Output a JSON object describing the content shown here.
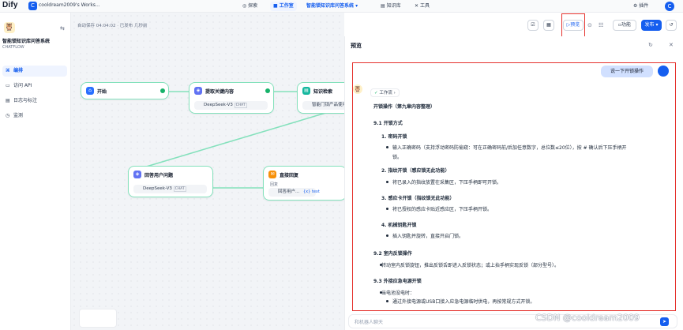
{
  "topbar": {
    "logo": "Dify",
    "ws_initial": "C",
    "ws_name": "cooldream2009's Works...",
    "explore": "探索",
    "studio": "工作室",
    "app_name": "智能锁知识库问答系统",
    "knowledge": "知识库",
    "tools": "工具",
    "account_menu": "插件",
    "user_initial": "C"
  },
  "sidebar": {
    "app_title": "智能锁知识库问答系统",
    "app_type": "CHATFLOW",
    "items": [
      {
        "label": "编排",
        "icon": "orchestrate-icon"
      },
      {
        "label": "访问 API",
        "icon": "api-icon"
      },
      {
        "label": "日志与标注",
        "icon": "log-icon"
      },
      {
        "label": "监测",
        "icon": "monitor-icon"
      }
    ]
  },
  "canvas": {
    "autosave": "自动保存 04:04:02 · 已发布 几秒前",
    "nodes": {
      "start": "开始",
      "extract": "提取关键内容",
      "extract_model": "DeepSeek-V3",
      "chat_tag": "CHAT",
      "kb": "知识检索",
      "kb_sub": "智能门锁产品使用手册",
      "answer_q": "回答用户问题",
      "answer_model": "DeepSeek-V3",
      "answer_tag": "CHAT",
      "direct": "直接回复",
      "direct_label": "回复",
      "direct_var": "回答用户...",
      "direct_var_type": "{x} text"
    }
  },
  "toolbar": {
    "preview": "预览",
    "features": "功能",
    "publish": "发布"
  },
  "preview": {
    "title": "预览",
    "user_msg": "说一下开锁操作",
    "workflow_label": "工作流",
    "input_placeholder": "和机器人聊天",
    "lines": [
      "开锁操作（第九章内容整理）",
      "9.1 开锁方式",
      "1. 密码开锁",
      "输入正确密码（支持浮动密码防偷窥：可在正确密码前/后加任意数字，总位数≤20位），按 # 确认后下压手柄开",
      "锁。",
      "2. 指纹开锁（感应锁无此功能）",
      "将已录入的指纹放置在采集区，下压手柄即可开锁。",
      "3. 感应卡开锁（指纹锁无此功能）",
      "将已授权的感应卡贴近感应区，下压手柄开锁。",
      "4. 机械钥匙开锁",
      "插入钥匙并旋转，直接开启门锁。",
      "9.2 室内反锁操作",
      "转动室内反锁旋钮，推出反锁舌即进入反锁状态；或上抬手柄实现反锁（部分型号）。",
      "9.3 外接应急电源开锁",
      "当电池没电时：",
      "通过外接电源或USB口接入应急电源临时供电，再按常规方式开锁。"
    ]
  },
  "watermark": "CSDN @cooldream2009",
  "colors": {
    "accent": "#155eef",
    "node_border": "#84e1bc",
    "success": "#17b26a",
    "highlight": "#e5322d"
  }
}
